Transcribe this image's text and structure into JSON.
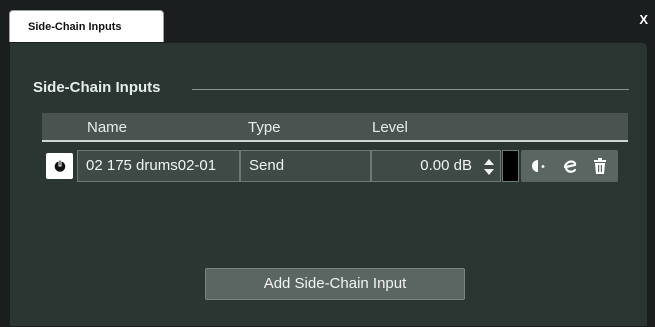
{
  "window": {
    "tab_title": "Side-Chain Inputs",
    "close_label": "X"
  },
  "section": {
    "title": "Side-Chain Inputs"
  },
  "table": {
    "columns": [
      "Name",
      "Type",
      "Level"
    ],
    "rows": [
      {
        "name": "02 175 drums02-01",
        "type": "Send",
        "level": "0.00 dB",
        "active": true
      }
    ]
  },
  "actions": {
    "add_button": "Add Side-Chain Input"
  },
  "icons": [
    "power-icon",
    "spin-arrows-icon",
    "pre-post-fader-icon",
    "edit-icon",
    "trash-icon"
  ],
  "colors": {
    "background": "#1b1e1e",
    "panel": "#2b3531",
    "header": "#4a5350",
    "cell": "#3f4946",
    "button": "#5b6663"
  }
}
